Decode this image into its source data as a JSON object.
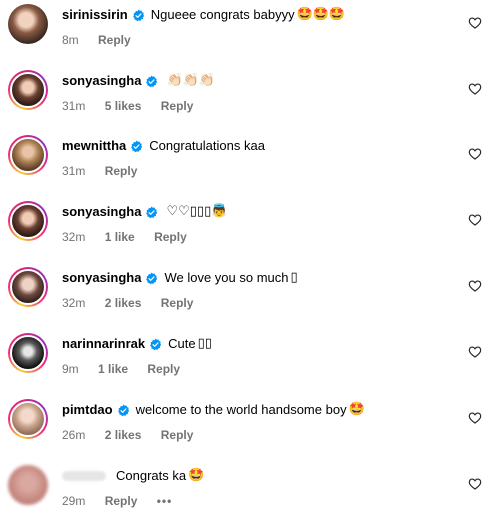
{
  "comments": [
    {
      "username": "sirinissirin",
      "text": "Ngueee congrats babyyy",
      "emoji": "🤩🤩🤩",
      "time": "8m",
      "likes": "",
      "reply": "Reply"
    },
    {
      "username": "sonyasingha",
      "text": "",
      "emoji": "👏🏻👏🏻👏🏻",
      "time": "31m",
      "likes": "5 likes",
      "reply": "Reply"
    },
    {
      "username": "mewnittha",
      "text": "Congratulations kaa",
      "emoji": "",
      "time": "31m",
      "likes": "",
      "reply": "Reply"
    },
    {
      "username": "sonyasingha",
      "text": "",
      "emoji": "♡♡▯▯▯👼",
      "time": "32m",
      "likes": "1 like",
      "reply": "Reply"
    },
    {
      "username": "sonyasingha",
      "text": "We love you so much",
      "emoji": "▯",
      "time": "32m",
      "likes": "2 likes",
      "reply": "Reply"
    },
    {
      "username": "narinnarinrak",
      "text": "Cute",
      "emoji": "▯▯",
      "time": "9m",
      "likes": "1 like",
      "reply": "Reply"
    },
    {
      "username": "pimtdao",
      "text": "welcome to the world handsome boy",
      "emoji": "🤩",
      "time": "26m",
      "likes": "2 likes",
      "reply": "Reply"
    },
    {
      "username": "",
      "text": "Congrats ka",
      "emoji": "🤩",
      "time": "29m",
      "likes": "",
      "reply": "Reply",
      "more": "•••"
    }
  ],
  "colors": {
    "verified": "#0095f6",
    "meta_text": "#737373",
    "ring_start": "#f9ce34",
    "ring_mid": "#ee2a7b",
    "ring_end": "#962fbf"
  },
  "icons": {
    "verified": "verified-badge-icon",
    "like": "heart-outline-icon",
    "more": "more-options-icon"
  }
}
